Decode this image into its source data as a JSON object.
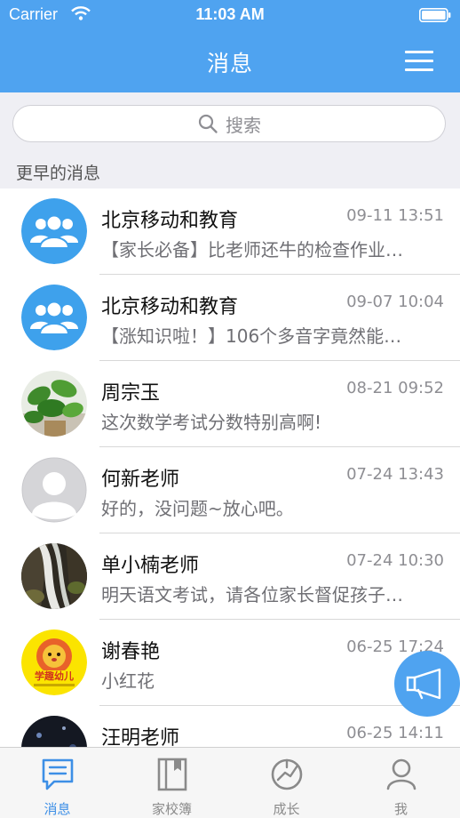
{
  "status_bar": {
    "carrier": "Carrier",
    "time": "11:03 AM"
  },
  "header": {
    "title": "消息"
  },
  "search": {
    "placeholder": "搜索"
  },
  "section": {
    "label": "更早的消息"
  },
  "messages": [
    {
      "name": "北京移动和教育",
      "time": "09-11 13:51",
      "preview": "【家长必备】比老师还牛的检查作业…",
      "avatar": "group-icon"
    },
    {
      "name": "北京移动和教育",
      "time": "09-07 10:04",
      "preview": "【涨知识啦！】106个多音字竟然能…",
      "avatar": "group-icon"
    },
    {
      "name": "周宗玉",
      "time": "08-21 09:52",
      "preview": "这次数学考试分数特别高啊!",
      "avatar": "plant-photo"
    },
    {
      "name": "何新老师",
      "time": "07-24 13:43",
      "preview": "好的，没问题~放心吧。",
      "avatar": "default-person"
    },
    {
      "name": "单小楠老师",
      "time": "07-24 10:30",
      "preview": "明天语文考试，请各位家长督促孩子…",
      "avatar": "waterfall-photo"
    },
    {
      "name": "谢春艳",
      "time": "06-25 17:24",
      "preview": "小红花",
      "avatar": "lion-logo"
    },
    {
      "name": "汪明老师",
      "time": "06-25 14:11",
      "preview": "",
      "avatar": "dark-photo"
    }
  ],
  "lion_logo_text": "学趣幼儿",
  "tabs": [
    {
      "label": "消息",
      "icon": "chat-icon",
      "active": true
    },
    {
      "label": "家校簿",
      "icon": "notebook-icon",
      "active": false
    },
    {
      "label": "成长",
      "icon": "growth-icon",
      "active": false
    },
    {
      "label": "我",
      "icon": "person-icon",
      "active": false
    }
  ],
  "colors": {
    "primary": "#4fa3f0",
    "tab_active": "#3d8fe6",
    "background": "#efeff4"
  }
}
